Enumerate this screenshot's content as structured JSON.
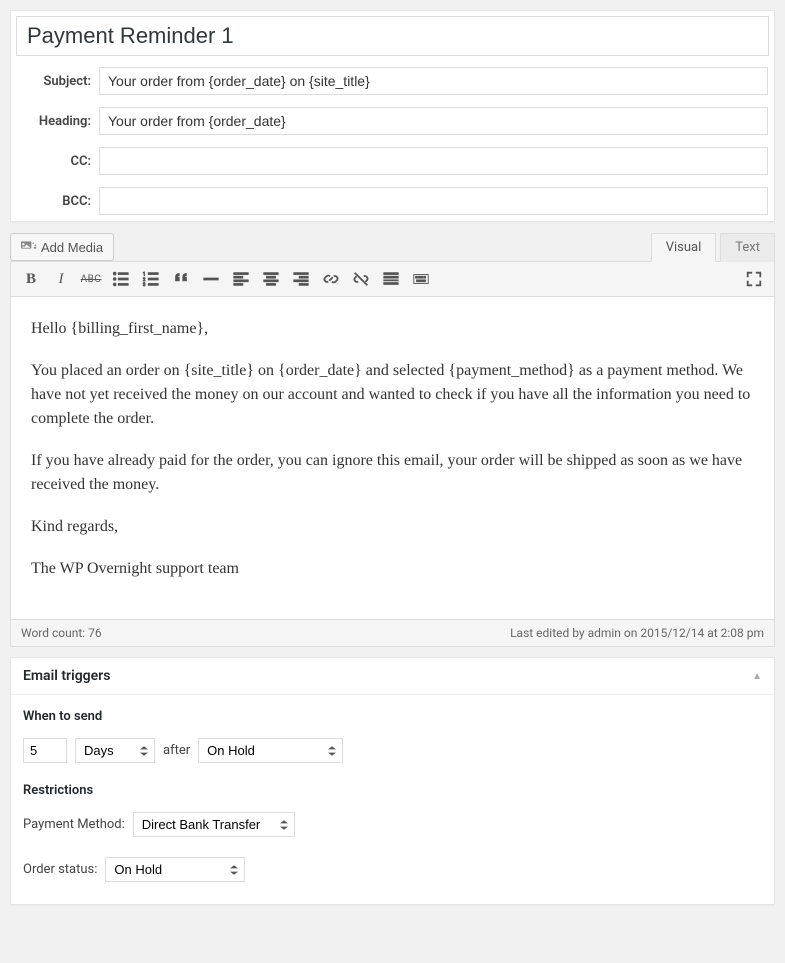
{
  "title": "Payment Reminder 1",
  "fields": {
    "subject": {
      "label": "Subject:",
      "value": "Your order from {order_date} on {site_title}"
    },
    "heading": {
      "label": "Heading:",
      "value": "Your order from {order_date}"
    },
    "cc": {
      "label": "CC:",
      "value": ""
    },
    "bcc": {
      "label": "BCC:",
      "value": ""
    }
  },
  "editor": {
    "add_media_label": "Add Media",
    "tabs": {
      "visual": "Visual",
      "text": "Text"
    },
    "content": {
      "p1": "Hello {billing_first_name},",
      "p2": "You placed an order on {site_title} on {order_date} and selected {payment_method} as a payment method. We have not yet received the money on our account and wanted to check if you have all the information you need to complete the order.",
      "p3": "If you have already paid for the order, you can ignore this email, your order will be shipped as soon as we have received the money.",
      "p4": "Kind regards,",
      "p5": "The WP Overnight support team"
    },
    "word_count_label": "Word count: 76",
    "last_edited": "Last edited by admin on 2015/12/14 at 2:08 pm"
  },
  "triggers": {
    "box_title": "Email triggers",
    "when_label": "When to send",
    "number_value": "5",
    "unit_value": "Days",
    "after_label": "after",
    "after_status": "On Hold",
    "restrictions_label": "Restrictions",
    "payment_method_label": "Payment Method:",
    "payment_method_value": "Direct Bank Transfer",
    "order_status_label": "Order status:",
    "order_status_value": "On Hold"
  }
}
